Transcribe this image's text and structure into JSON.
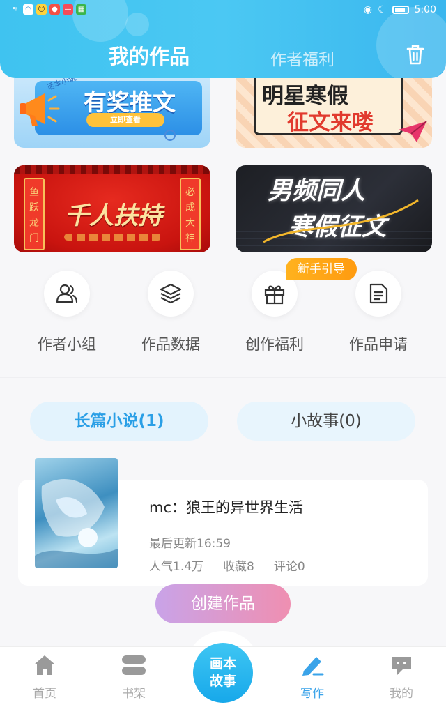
{
  "status_bar": {
    "time": "5:00"
  },
  "header": {
    "tab_active": "我的作品",
    "tab_other": "作者福利"
  },
  "banners": [
    {
      "title": "有奖推文",
      "tag": "话本小说",
      "button": "立即查看"
    },
    {
      "title_line1": "明星寒假",
      "title_line2": "征文来喽"
    },
    {
      "title": "千人扶持",
      "left_couplet": "鱼跃龙门",
      "right_couplet": "必成大神"
    },
    {
      "title_line1": "男频同人",
      "title_line2": "寒假征文"
    }
  ],
  "guide_badge": "新手引导",
  "functions": [
    {
      "label": "作者小组",
      "icon": "people-icon"
    },
    {
      "label": "作品数据",
      "icon": "layers-icon"
    },
    {
      "label": "创作福利",
      "icon": "gift-icon"
    },
    {
      "label": "作品申请",
      "icon": "document-icon"
    }
  ],
  "work_tabs": {
    "novel": "长篇小说(1)",
    "story": "小故事(0)"
  },
  "work": {
    "title": "mc：狼王的异世界生活",
    "updated": "最后更新16:59",
    "popularity": "人气1.4万",
    "favorites": "收藏8",
    "comments": "评论0"
  },
  "create_button": "创建作品",
  "bottom_nav": {
    "home": "首页",
    "shelf": "书架",
    "center_line1": "画本",
    "center_line2": "故事",
    "write": "写作",
    "mine": "我的"
  },
  "colors": {
    "header": "#3fc3f0",
    "accent": "#2a9fe6",
    "create_gradient_start": "#c9a3e8",
    "create_gradient_end": "#ef8fb1",
    "guide": "#ffa616"
  }
}
